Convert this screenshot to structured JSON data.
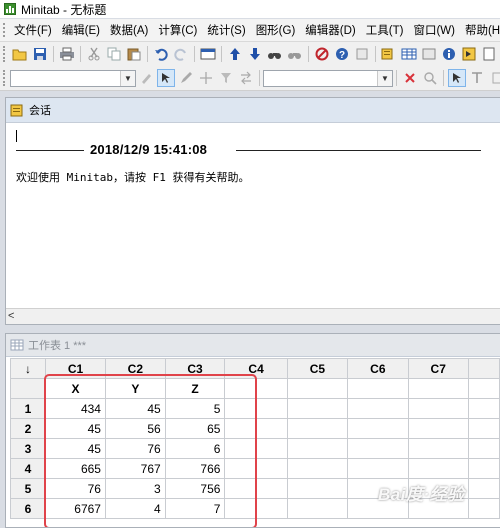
{
  "window": {
    "title": "Minitab - 无标题"
  },
  "menu": [
    "文件(F)",
    "编辑(E)",
    "数据(A)",
    "计算(C)",
    "统计(S)",
    "图形(G)",
    "编辑器(D)",
    "工具(T)",
    "窗口(W)",
    "帮助(H)"
  ],
  "session": {
    "title": "会话",
    "datetime": "2018/12/9 15:41:08",
    "welcome": "欢迎使用 Minitab，请按 F1 获得有关帮助。",
    "scroll_left": "<"
  },
  "worksheet": {
    "title": "工作表 1 ***",
    "corner": "↓",
    "columns": [
      "C1",
      "C2",
      "C3",
      "C4",
      "C5",
      "C6",
      "C7"
    ],
    "names": [
      "X",
      "Y",
      "Z",
      "",
      "",
      "",
      ""
    ],
    "rows": [
      {
        "n": "1",
        "cells": [
          "434",
          "45",
          "5",
          "",
          "",
          "",
          ""
        ]
      },
      {
        "n": "2",
        "cells": [
          "45",
          "56",
          "65",
          "",
          "",
          "",
          ""
        ]
      },
      {
        "n": "3",
        "cells": [
          "45",
          "76",
          "6",
          "",
          "",
          "",
          ""
        ]
      },
      {
        "n": "4",
        "cells": [
          "665",
          "767",
          "766",
          "",
          "",
          "",
          ""
        ]
      },
      {
        "n": "5",
        "cells": [
          "76",
          "3",
          "756",
          "",
          "",
          "",
          ""
        ]
      },
      {
        "n": "6",
        "cells": [
          "6767",
          "4",
          "7",
          "",
          "",
          "",
          ""
        ]
      }
    ]
  },
  "watermark": "Bai度·经验",
  "toolbar1_icons": [
    "open-icon",
    "save-icon",
    "print-icon",
    "cut-icon",
    "copy-icon",
    "paste-icon",
    "undo-icon",
    "redo-icon",
    "window-icon",
    "arrow-up-icon",
    "arrow-down-icon",
    "find-icon",
    "find-next-icon",
    "cancel-icon",
    "help-icon",
    "stop-icon",
    "session-icon",
    "data-icon",
    "info-icon",
    "project-icon",
    "report-icon",
    "new-icon"
  ],
  "toolbar2_icons": [
    "brush-icon",
    "select-icon",
    "pen-icon",
    "crosshair-icon",
    "filter-icon",
    "swap-icon",
    "delete-icon",
    "zoom-icon",
    "pointer-icon",
    "text-icon"
  ],
  "colors": {
    "accent_red": "#e0434a",
    "header_blue": "#dde6f1"
  }
}
